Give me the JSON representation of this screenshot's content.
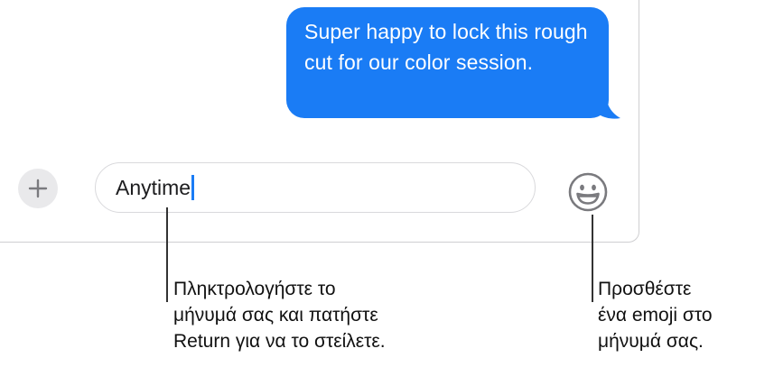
{
  "conversation": {
    "sent_message": "Super happy to lock this rough cut for our color session."
  },
  "composer": {
    "add_icon": "plus-icon",
    "input_value": "Anytime",
    "emoji_icon": "smiley-face-icon"
  },
  "callouts": {
    "message_field": "Πληκτρολογήστε το\nμήνυμά σας και πατήστε\nReturn για να το στείλετε.",
    "emoji_button": "Προσθέστε\nένα emoji στο\nμήνυμά σας."
  },
  "colors": {
    "sent_bubble": "#1a7cf5",
    "caret": "#1a7cf5"
  }
}
